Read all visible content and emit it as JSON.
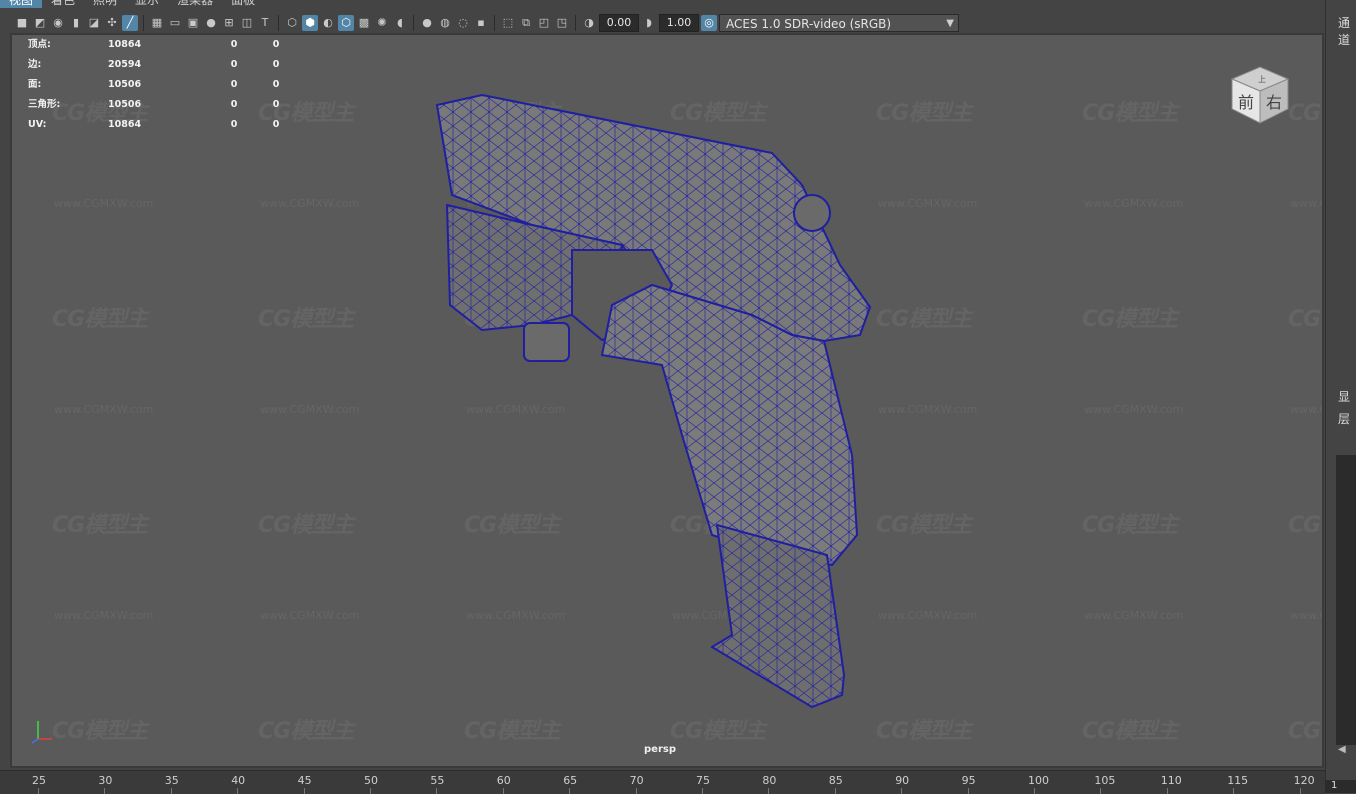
{
  "menu": {
    "items": [
      "视图",
      "着色",
      "照明",
      "显示",
      "渲染器",
      "面板"
    ]
  },
  "toolbar": {
    "exposure": "0.00",
    "gamma": "1.00",
    "colorspace": "ACES 1.0 SDR-video (sRGB)",
    "icons_left": [
      "camera-icon",
      "camera-attr-icon",
      "snapshot-icon",
      "bookmark-icon",
      "image-plane-icon",
      "lock-camera-icon",
      "2d-pan-icon"
    ],
    "icons_grid": [
      "grid-icon",
      "film-gate-icon",
      "resolution-gate-icon",
      "gate-mask-icon",
      "field-chart-icon",
      "safe-action-icon",
      "safe-title-icon"
    ],
    "icons_shading": [
      "wireframe-icon",
      "smooth-shade-icon",
      "default-material-icon",
      "wireframe-on-shaded-icon",
      "textured-icon",
      "lights-icon",
      "shadows-icon"
    ],
    "icons_render": [
      "screen-space-ao-icon",
      "motion-blur-icon",
      "antialias-icon",
      "depth-of-field-icon"
    ],
    "icons_isolate": [
      "isolate-select-icon",
      "xray-icon",
      "xray-joints-icon",
      "backface-culling-icon"
    ]
  },
  "hud": {
    "rows": [
      {
        "label": "顶点:",
        "v1": "10864",
        "v2": "0",
        "v3": "0"
      },
      {
        "label": "边:",
        "v1": "20594",
        "v2": "0",
        "v3": "0"
      },
      {
        "label": "面:",
        "v1": "10506",
        "v2": "0",
        "v3": "0"
      },
      {
        "label": "三角形:",
        "v1": "10506",
        "v2": "0",
        "v3": "0"
      },
      {
        "label": "UV:",
        "v1": "10864",
        "v2": "0",
        "v3": "0"
      }
    ]
  },
  "viewport": {
    "camera": "persp",
    "watermark_logo": "CG模型主",
    "watermark_url": "www.CGMXW.com",
    "viewcube": {
      "top": "上",
      "front": "前",
      "right": "右"
    }
  },
  "right_panel": {
    "top_label": "通道",
    "mid_label_1": "显",
    "mid_label_2": "层"
  },
  "timeline": {
    "ticks": [
      "25",
      "30",
      "35",
      "40",
      "45",
      "50",
      "55",
      "60",
      "65",
      "70",
      "75",
      "80",
      "85",
      "90",
      "95",
      "100",
      "105",
      "110",
      "115",
      "120"
    ],
    "current_frame": "1"
  },
  "colors": {
    "wire": "#1f1fa0",
    "model": "#7a7a7a",
    "viewport_bg": "#5a5a5a",
    "accent": "#5285a6"
  }
}
